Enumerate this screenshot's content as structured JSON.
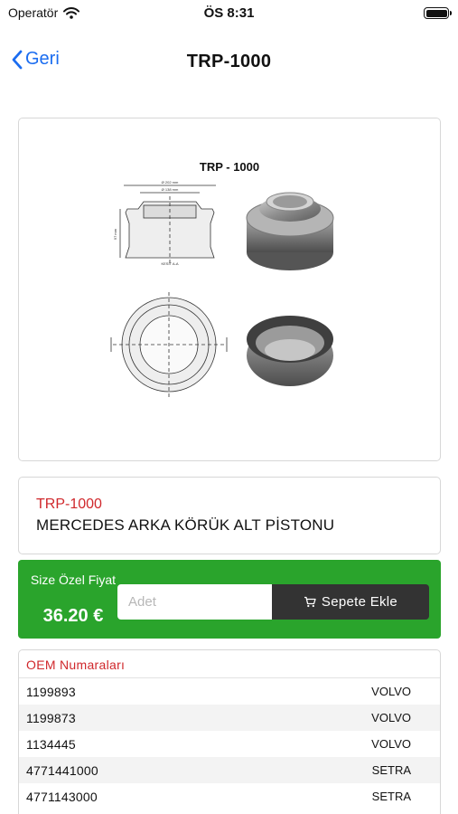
{
  "status": {
    "carrier": "Operatör",
    "time": "ÖS 8:31"
  },
  "nav": {
    "back_label": "Geri",
    "title": "TRP-1000"
  },
  "product_image": {
    "title": "TRP - 1000",
    "dim_outer": "Ø 202 mm",
    "dim_inner": "Ø 138 mm",
    "dim_height": "97 mm",
    "section_label": "KESİT A-A"
  },
  "product": {
    "code": "TRP-1000",
    "name": "MERCEDES ARKA KÖRÜK ALT PİSTONU"
  },
  "price": {
    "label": "Size Özel Fiyat",
    "value": "36.20 €",
    "qty_placeholder": "Adet",
    "add_to_cart_label": "Sepete Ekle",
    "accent_color": "#2aa42c"
  },
  "oem": {
    "title": "OEM Numaraları",
    "rows": [
      {
        "code": "1199893",
        "brand": "VOLVO"
      },
      {
        "code": "1199873",
        "brand": "VOLVO"
      },
      {
        "code": "1134445",
        "brand": "VOLVO"
      },
      {
        "code": "4771441000",
        "brand": "SETRA"
      },
      {
        "code": "4771143000",
        "brand": "SETRA"
      }
    ]
  }
}
